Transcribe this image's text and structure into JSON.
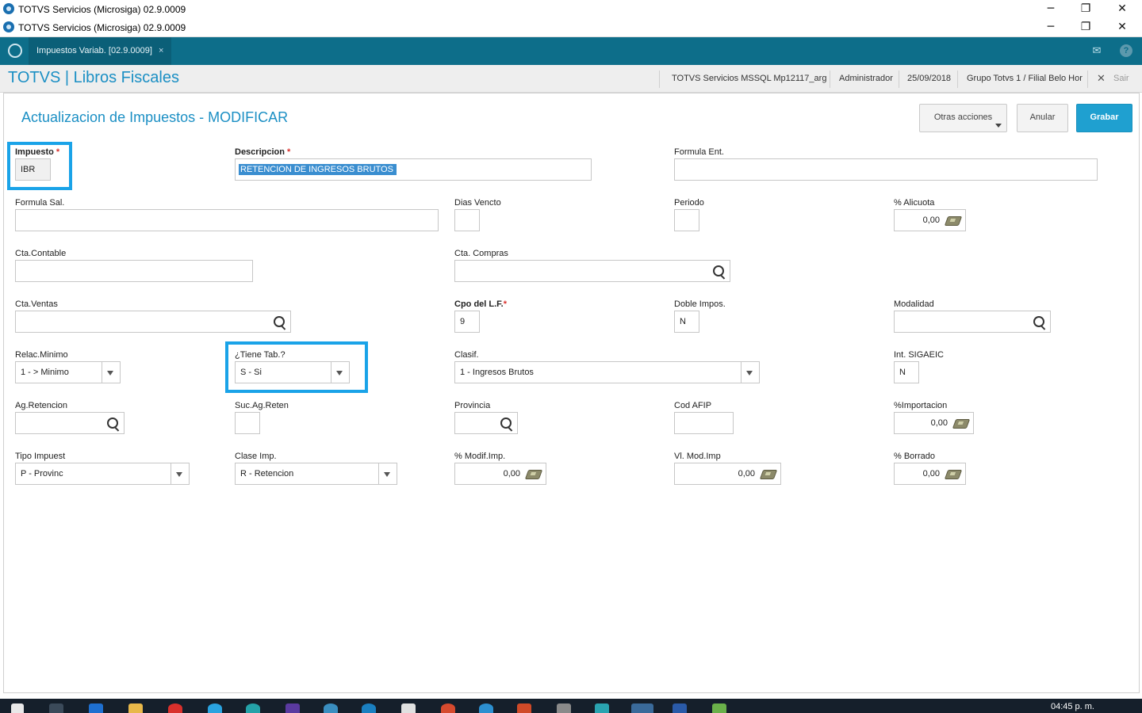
{
  "window": {
    "outer_title": "TOTVS Servicios (Microsiga) 02.9.0009",
    "inner_title": "TOTVS Servicios (Microsiga) 02.9.0009",
    "minimize": "─",
    "restore": "❐",
    "close": "✕"
  },
  "appbar": {
    "tab_label": "Impuestos Variab. [02.9.0009]",
    "tab_close": "×",
    "mail_icon": "✉",
    "help_icon": "?"
  },
  "header": {
    "brand": "TOTVS | Libros Fiscales",
    "environment": "TOTVS Servicios MSSQL Mp12117_arg",
    "user": "Administrador",
    "date": "25/09/2018",
    "branch": "Grupo Totvs 1 / Filial Belo Hor",
    "exit_label": "Sair",
    "exit_icon": "✕"
  },
  "page": {
    "title": "Actualizacion de Impuestos - MODIFICAR",
    "buttons": {
      "otras": "Otras acciones",
      "anular": "Anular",
      "grabar": "Grabar"
    }
  },
  "fields": {
    "impuesto": {
      "label": "Impuesto",
      "value": "IBR",
      "required": "*"
    },
    "descripcion": {
      "label": "Descripcion",
      "value": "RETENCION DE INGRESOS BRUTOS",
      "required": "*"
    },
    "formula_ent": {
      "label": "Formula Ent.",
      "value": ""
    },
    "formula_sal": {
      "label": "Formula Sal.",
      "value": ""
    },
    "dias_vencto": {
      "label": "Dias Vencto",
      "value": ""
    },
    "periodo": {
      "label": "Periodo",
      "value": ""
    },
    "alicuota": {
      "label": "% Alicuota",
      "value": "0,00"
    },
    "cta_contable": {
      "label": "Cta.Contable",
      "value": ""
    },
    "cta_compras": {
      "label": "Cta. Compras",
      "value": ""
    },
    "cta_ventas": {
      "label": "Cta.Ventas",
      "value": ""
    },
    "cpo_lf": {
      "label": "Cpo del L.F.",
      "value": "9",
      "required": "*"
    },
    "doble_impos": {
      "label": "Doble Impos.",
      "value": "N"
    },
    "modalidad": {
      "label": "Modalidad",
      "value": ""
    },
    "relac_minimo": {
      "label": "Relac.Minimo",
      "value": "1 - > Minimo"
    },
    "tiene_tab": {
      "label": "¿Tiene Tab.?",
      "value": "S - Si"
    },
    "clasif": {
      "label": "Clasif.",
      "value": "1 - Ingresos Brutos"
    },
    "int_sigaeic": {
      "label": "Int. SIGAEIC",
      "value": "N"
    },
    "ag_retencion": {
      "label": "Ag.Retencion",
      "value": ""
    },
    "suc_ag_reten": {
      "label": "Suc.Ag.Reten",
      "value": ""
    },
    "provincia": {
      "label": "Provincia",
      "value": ""
    },
    "cod_afip": {
      "label": "Cod AFIP",
      "value": ""
    },
    "importacion": {
      "label": "%Importacion",
      "value": "0,00"
    },
    "tipo_impuest": {
      "label": "Tipo Impuest",
      "value": "P - Provinc"
    },
    "clase_imp": {
      "label": "Clase Imp.",
      "value": "R - Retencion"
    },
    "modif_imp": {
      "label": "% Modif.Imp.",
      "value": "0,00"
    },
    "vl_mod_imp": {
      "label": "Vl. Mod.Imp",
      "value": "0,00"
    },
    "borrado": {
      "label": "% Borrado",
      "value": "0,00"
    }
  },
  "taskbar": {
    "clock": "04:45 p. m."
  },
  "colors": {
    "accent": "#1b8fc4",
    "appbar": "#0d6e8a",
    "highlight": "#1aa3e8",
    "primary_button": "#1fa0d0"
  }
}
